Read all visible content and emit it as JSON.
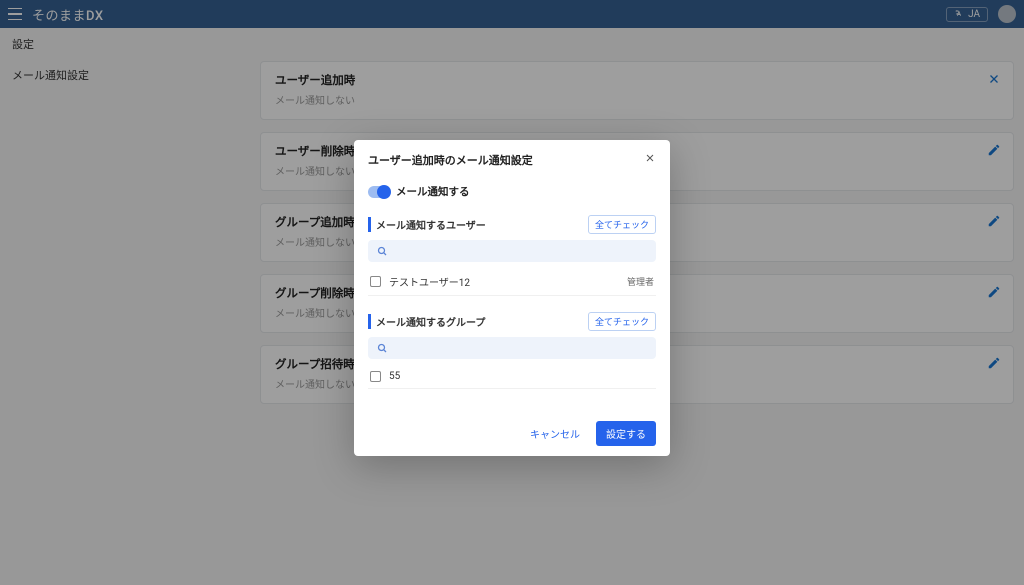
{
  "topbar": {
    "brand": "そのままDX",
    "langLabel": "JA"
  },
  "page": {
    "title": "設定"
  },
  "sidebar": {
    "items": [
      {
        "label": "メール通知設定"
      }
    ]
  },
  "cards": [
    {
      "title": "ユーザー追加時",
      "sub": "メール通知しない",
      "icon": "close"
    },
    {
      "title": "ユーザー削除時",
      "sub": "メール通知しない",
      "icon": "edit"
    },
    {
      "title": "グループ追加時",
      "sub": "メール通知しない",
      "icon": "edit"
    },
    {
      "title": "グループ削除時",
      "sub": "メール通知しない",
      "icon": "edit"
    },
    {
      "title": "グループ招待時",
      "sub": "メール通知しない",
      "icon": "edit"
    }
  ],
  "dialog": {
    "title": "ユーザー追加時のメール通知設定",
    "toggleLabel": "メール通知する",
    "userSection": {
      "title": "メール通知するユーザー",
      "checkAll": "全てチェック",
      "rows": [
        {
          "label": "テストユーザー12",
          "role": "管理者"
        }
      ]
    },
    "groupSection": {
      "title": "メール通知するグループ",
      "checkAll": "全てチェック",
      "rows": [
        {
          "label": "55"
        }
      ]
    },
    "cancel": "キャンセル",
    "submit": "設定する"
  }
}
